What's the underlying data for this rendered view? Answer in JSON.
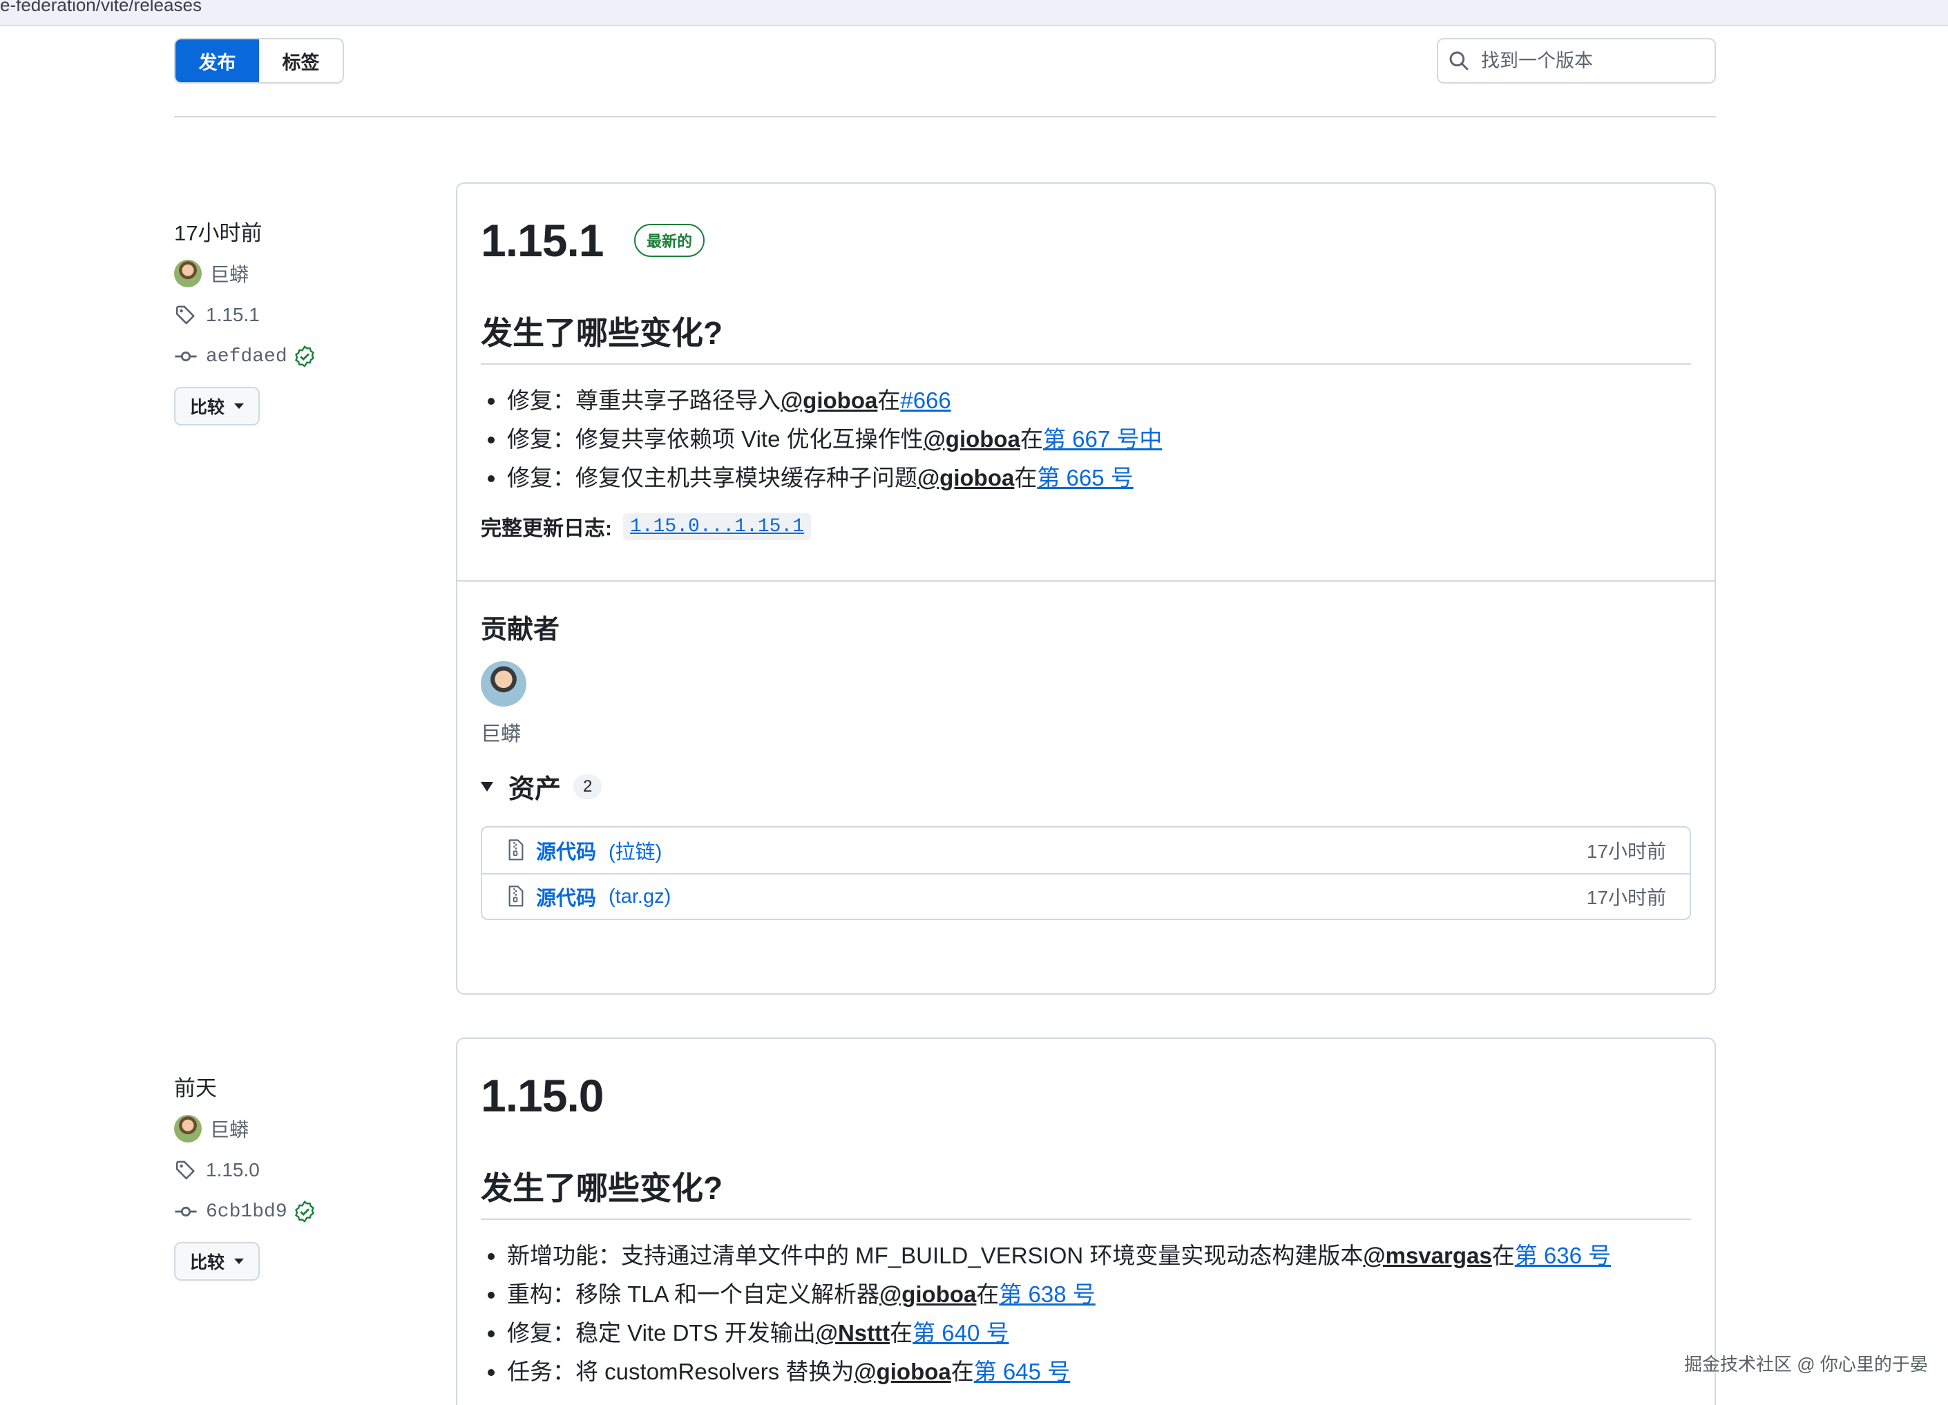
{
  "url_fragment": "e-federation/vite/releases",
  "tabs": {
    "releases": "发布",
    "tags": "标签"
  },
  "search": {
    "placeholder": "找到一个版本"
  },
  "releases": [
    {
      "when": "17小时前",
      "author": "巨蟒",
      "tag": "1.15.1",
      "commit": "aefdaed",
      "compare_label": "比较",
      "version": "1.15.1",
      "latest_badge": "最新的",
      "section_heading": "发生了哪些变化?",
      "changes": [
        {
          "text": "修复：尊重共享子路径导入",
          "mention": "@gioboa",
          "in": "在",
          "link": "#666"
        },
        {
          "text": "修复：修复共享依赖项 Vite 优化互操作性",
          "mention": "@gioboa",
          "in": "在",
          "link": "第 667 号中"
        },
        {
          "text": "修复：修复仅主机共享模块缓存种子问题",
          "mention": "@gioboa",
          "in": "在",
          "link": "第 665 号"
        }
      ],
      "full_changelog_label": "完整更新日志:",
      "full_changelog_link": "1.15.0...1.15.1",
      "contributors_heading": "贡献者",
      "contributor_name": "巨蟒",
      "assets_heading": "资产",
      "assets_count": "2",
      "assets": [
        {
          "name": "源代码",
          "ext": "(拉链)",
          "time": "17小时前"
        },
        {
          "name": "源代码",
          "ext": "(tar.gz)",
          "time": "17小时前"
        }
      ]
    },
    {
      "when": "前天",
      "author": "巨蟒",
      "tag": "1.15.0",
      "commit": "6cb1bd9",
      "compare_label": "比较",
      "version": "1.15.0",
      "section_heading": "发生了哪些变化?",
      "changes": [
        {
          "text": "新增功能：支持通过清单文件中的 MF_BUILD_VERSION 环境变量实现动态构建版本",
          "mention": "@msvargas",
          "in": "在",
          "link": "第 636 号"
        },
        {
          "text": "重构：移除 TLA 和一个自定义解析器",
          "mention": "@gioboa",
          "in": "在",
          "link": "第 638 号"
        },
        {
          "text": "修复：稳定 Vite DTS 开发输出",
          "mention": "@Nsttt",
          "in": "在",
          "link": "第 640 号"
        },
        {
          "text": "任务：将 customResolvers 替换为",
          "mention": "@gioboa",
          "in": "在",
          "link": "第 645 号"
        }
      ]
    }
  ],
  "watermark": "掘金技术社区 @ 你心里的于晏",
  "colors": {
    "accent": "#0969da",
    "latest": "#1a7f37",
    "verified": "#1a7f37",
    "border": "#d1d9e0"
  }
}
